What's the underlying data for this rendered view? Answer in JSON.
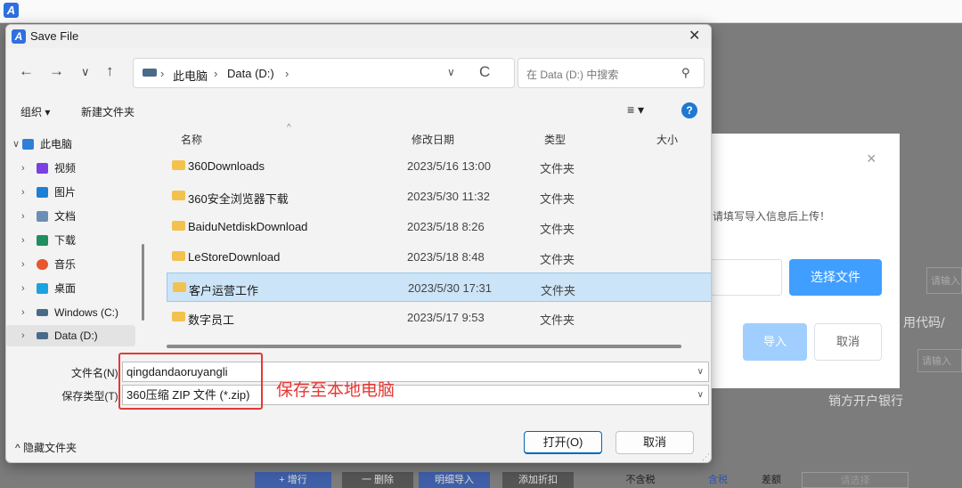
{
  "app": {
    "logo_letter": "A"
  },
  "dialog": {
    "title": "Save File",
    "nav": {
      "back": "←",
      "forward": "→",
      "down": "∨",
      "up": "↑",
      "refresh": "C"
    },
    "breadcrumb": [
      "此电脑",
      "Data (D:)"
    ],
    "search_placeholder": "在 Data (D:) 中搜索",
    "toolbar": {
      "organize": "组织 ▾",
      "new_folder": "新建文件夹",
      "help": "?"
    },
    "sidebar": [
      {
        "label": "此电脑",
        "expanded": true,
        "icon": "pc-icon",
        "color": "#2f7fd8"
      },
      {
        "label": "视频",
        "icon": "video-icon",
        "color": "#7b3fe4"
      },
      {
        "label": "图片",
        "icon": "pictures-icon",
        "color": "#1f7fd6"
      },
      {
        "label": "文档",
        "icon": "documents-icon",
        "color": "#6d8fb5"
      },
      {
        "label": "下载",
        "icon": "downloads-icon",
        "color": "#1f8f5f"
      },
      {
        "label": "音乐",
        "icon": "music-icon",
        "color": "#e8562d"
      },
      {
        "label": "桌面",
        "icon": "desktop-icon",
        "color": "#1aa3e0"
      },
      {
        "label": "Windows (C:)",
        "icon": "drive-c-icon",
        "color": "#4a6a8a"
      },
      {
        "label": "Data (D:)",
        "icon": "drive-d-icon",
        "color": "#4a6a8a",
        "selected": true
      }
    ],
    "columns": {
      "name": "名称",
      "modified": "修改日期",
      "type": "类型",
      "size": "大小"
    },
    "files": [
      {
        "name": "360Downloads",
        "modified": "2023/5/16 13:00",
        "type": "文件夹"
      },
      {
        "name": "360安全浏览器下载",
        "modified": "2023/5/30 11:32",
        "type": "文件夹"
      },
      {
        "name": "BaiduNetdiskDownload",
        "modified": "2023/5/18 8:26",
        "type": "文件夹"
      },
      {
        "name": "LeStoreDownload",
        "modified": "2023/5/18 8:48",
        "type": "文件夹"
      },
      {
        "name": "客户运营工作",
        "modified": "2023/5/30 17:31",
        "type": "文件夹",
        "selected": true
      },
      {
        "name": "数字员工",
        "modified": "2023/5/17 9:53",
        "type": "文件夹"
      }
    ],
    "filename_label": "文件名(N):",
    "filename_value": "qingdandaoruyangli",
    "filetype_label": "保存类型(T):",
    "filetype_value": "360压缩 ZIP 文件 (*.zip)",
    "annotation": "保存至本地电脑",
    "hide_folders": "隐藏文件夹",
    "open_button": "打开(O)",
    "cancel_button": "取消"
  },
  "background": {
    "hint": "请填写导入信息后上传！",
    "select_file": "选择文件",
    "import": "导入",
    "cancel": "取消",
    "credit_code": "用代码/",
    "bank": "销方开户银行",
    "please_input": "请输入",
    "please_input2": "请输入",
    "strip": {
      "add_row": "+ 增行",
      "delete_row": "一 删除",
      "detail_import": "明细导入",
      "add_discount": "添加折扣",
      "no_tax": "不含税",
      "with_tax": "含税",
      "diff": "差额",
      "please_select": "请选择"
    }
  },
  "colors": {
    "accent": "#409eff",
    "annotation": "#e53935",
    "selection": "#cce4f7"
  }
}
